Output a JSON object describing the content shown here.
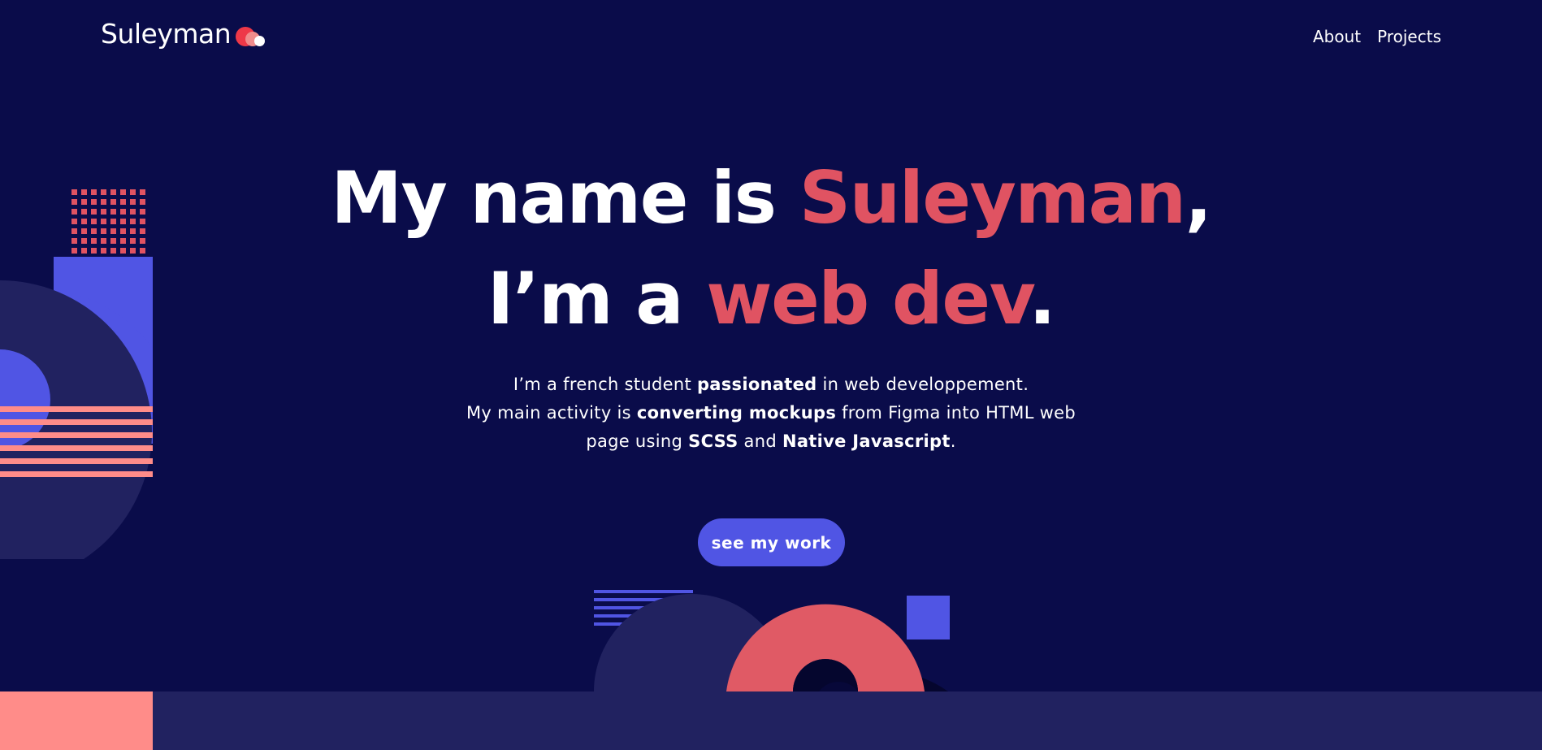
{
  "header": {
    "logo_text": "Suleyman",
    "nav": [
      {
        "label": "About"
      },
      {
        "label": "Projects"
      }
    ]
  },
  "hero": {
    "line1": {
      "prefix": "My name is ",
      "highlight": "Suleyman",
      "suffix": ","
    },
    "line2": {
      "prefix": "I’m a ",
      "highlight": "web dev",
      "suffix": "."
    },
    "intro": {
      "p1_a": "I’m a french student ",
      "p1_b": "passionated",
      "p1_c": " in web developpement.",
      "p2_a": "My main activity is ",
      "p2_b": "converting mockups",
      "p2_c": " from Figma into HTML web page using ",
      "p2_d": "SCSS",
      "p2_e": " and ",
      "p2_f": "Native Javascript",
      "p2_g": "."
    },
    "cta_label": "see my work"
  },
  "colors": {
    "background": "#0a0c4a",
    "accent_red": "#e05362",
    "accent_blue": "#5055e4",
    "accent_pink": "#ff8c89",
    "muted_navy": "#212260"
  },
  "icons": [
    "logo-dots-icon"
  ]
}
